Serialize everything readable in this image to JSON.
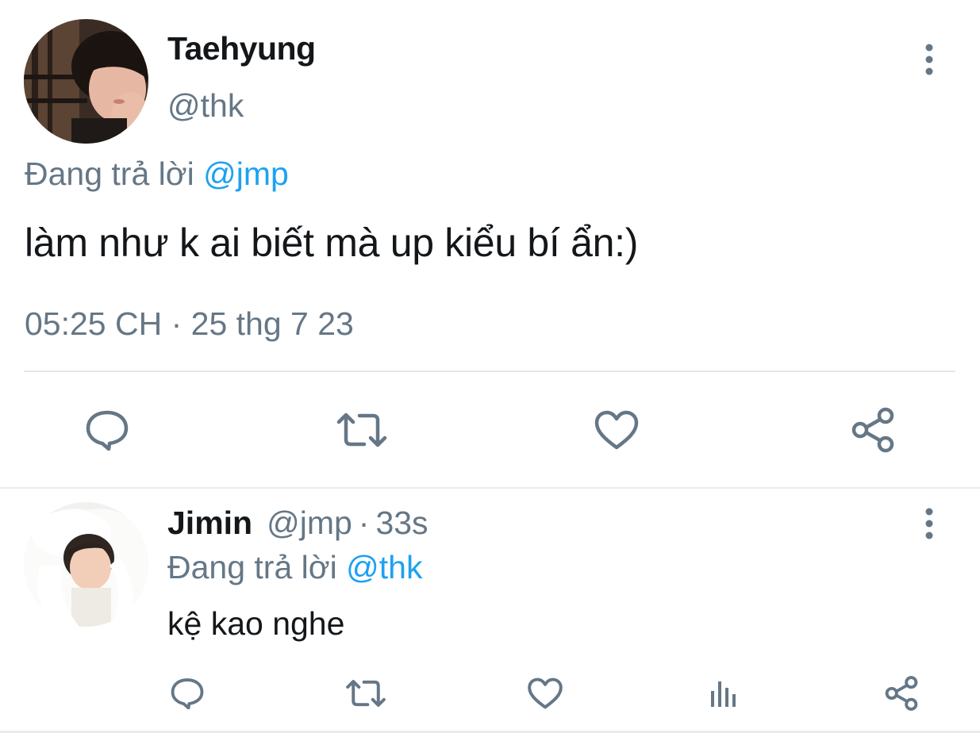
{
  "main_tweet": {
    "author_name": "Taehyung",
    "author_handle": "@thk",
    "replying_prefix": "Đang trả lời",
    "replying_to": "@jmp",
    "text": "làm như k ai biết mà up kiểu bí ẩn:)",
    "timestamp": "05:25 CH · 25 thg 7 23",
    "actions": [
      "reply-icon",
      "retweet-icon",
      "like-icon",
      "share-icon"
    ]
  },
  "reply_tweet": {
    "author_name": "Jimin",
    "author_handle": "@jmp",
    "separator": "·",
    "time_ago": "33s",
    "replying_prefix": "Đang trả lời",
    "replying_to": "@thk",
    "text": "kệ kao nghe",
    "actions": [
      "reply-icon",
      "retweet-icon",
      "like-icon",
      "analytics-icon",
      "share-icon"
    ]
  },
  "colors": {
    "text_primary": "#14171a",
    "text_secondary": "#657786",
    "accent": "#1da1f2",
    "divider": "#e1e8ed"
  }
}
